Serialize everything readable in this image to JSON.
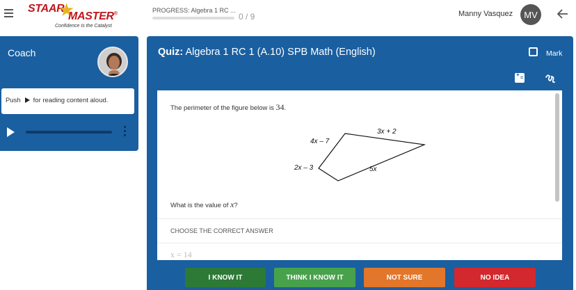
{
  "brand": {
    "word1": "STAAR",
    "word2": "MASTER",
    "trademark": "®",
    "tagline": "Confidence Is the Catalyst"
  },
  "progress": {
    "label": "PROGRESS: Algebra 1 RC ...",
    "count": "0 / 9",
    "fraction": 0
  },
  "user": {
    "name": "Manny Vasquez",
    "initials": "MV"
  },
  "coach": {
    "title": "Coach",
    "speech_before": "Push",
    "speech_after": "for reading content aloud.",
    "audio_progress": 0
  },
  "quiz": {
    "title_prefix": "Quiz:",
    "title": "Algebra 1 RC 1 (A.10) SPB Math (English)",
    "mark_label": "Mark",
    "question_text": "The perimeter of the figure below is",
    "question_value": "34",
    "question_end": ".",
    "figure_labels": {
      "top_left": "4x – 7",
      "top": "3x + 2",
      "left": "2x – 3",
      "bottom": "5x"
    },
    "prompt_text": "What is the value of",
    "prompt_var": "x",
    "prompt_end": "?",
    "choose_label": "CHOOSE THE CORRECT ANSWER",
    "answer_preview": "x = 14"
  },
  "buttons": {
    "know": "I KNOW IT",
    "think": "THINK I KNOW IT",
    "not_sure": "NOT SURE",
    "no_idea": "NO IDEA"
  },
  "icons": {
    "menu": "hamburger-icon",
    "back": "arrow-left-icon",
    "mark": "checkbox-icon",
    "calculator": "calculator-icon",
    "scratchpad": "scribble-icon",
    "play": "play-icon",
    "more": "more-vertical-icon"
  }
}
